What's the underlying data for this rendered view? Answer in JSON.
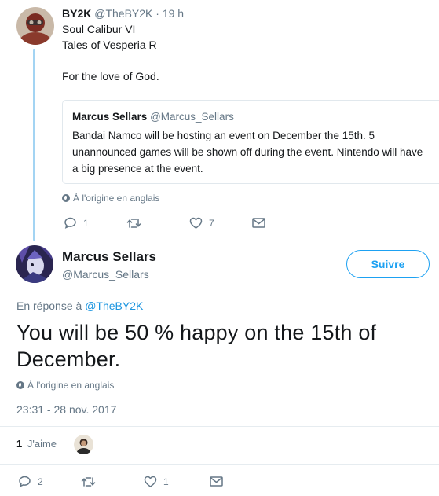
{
  "parent_tweet": {
    "author_name": "BY2K",
    "author_handle": "@TheBY2K",
    "separator": "·",
    "time_ago": "19 h",
    "text_lines": [
      "Soul Calibur VI",
      "Tales of Vesperia R",
      "For the love of God."
    ],
    "quote": {
      "author_name": "Marcus Sellars",
      "author_handle": "@Marcus_Sellars",
      "text_lines": [
        "Bandai Namco will be hosting an event on December the 15th. 5",
        "unannounced games will be shown off during the event. Nintendo will have",
        "a big presence at the event."
      ]
    },
    "translate_note": "À l'origine en anglais",
    "actions": {
      "replies": "1",
      "retweets": "",
      "likes": "7"
    }
  },
  "main_tweet": {
    "author_name": "Marcus Sellars",
    "author_handle": "@Marcus_Sellars",
    "follow_label": "Suivre",
    "reply_prefix": "En réponse à",
    "reply_handle": "@TheBY2K",
    "text": "You will be 50 % happy on the 15th of December.",
    "translate_note": "À l'origine en anglais",
    "timestamp": "23:31 - 28 nov. 2017",
    "like_count": "1",
    "like_label": "J'aime",
    "actions": {
      "replies": "2",
      "retweets": "",
      "likes": "1"
    }
  },
  "colors": {
    "accent": "#1da1f2",
    "link": "#1b95e0",
    "muted": "#657786",
    "thread_line": "#a3d4f3",
    "border": "#e1e8ed"
  },
  "icons": [
    "reply-icon",
    "retweet-icon",
    "heart-icon",
    "envelope-icon",
    "globe-icon"
  ]
}
